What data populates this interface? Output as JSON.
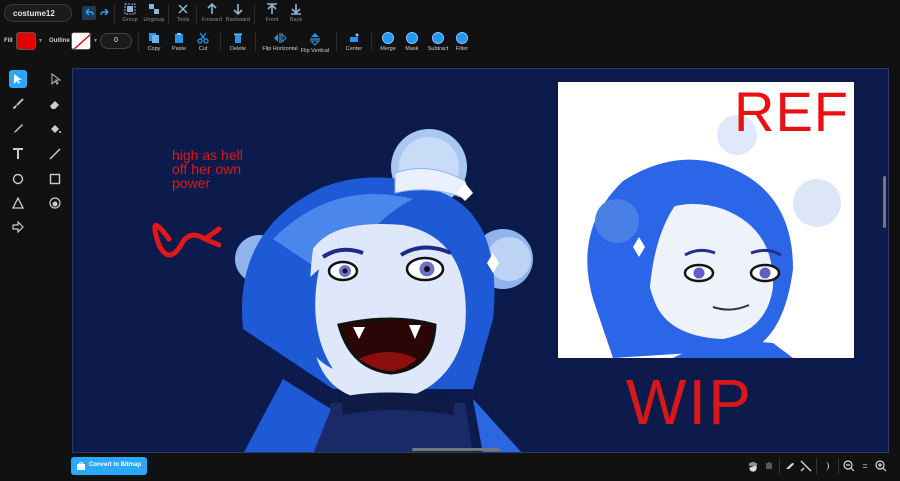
{
  "costume": {
    "name": "costume12"
  },
  "toolbar": {
    "group": "Group",
    "ungroup": "Ungroup",
    "tools": "Tools",
    "forward": "Forward",
    "backward": "Backward",
    "front": "Front",
    "back": "Back"
  },
  "style": {
    "fill_label": "Fill",
    "outline_label": "Outline",
    "fill_color": "#e60000",
    "outline_color": "none",
    "stroke_width": "0"
  },
  "edit": {
    "copy": "Copy",
    "paste": "Paste",
    "cut": "Cut",
    "delete": "Delete",
    "flip_horizontal": "Flip Horizontal",
    "flip_vertical": "Flip Vertical",
    "center": "Center",
    "merge": "Merge",
    "mask": "Mask",
    "subtract": "Subtract",
    "filter": "Filter"
  },
  "canvas": {
    "annotation_lines": [
      "high as hell",
      "off her own",
      "power"
    ],
    "ref_label": "REF",
    "wip_label": "WIP",
    "background_color": "#0b1a4a"
  },
  "bottom": {
    "convert_button": "Convert to Bitmap",
    "zoom_reset": "="
  },
  "colors": {
    "accent": "#2aa7ff",
    "annotation_red": "#e01818"
  }
}
